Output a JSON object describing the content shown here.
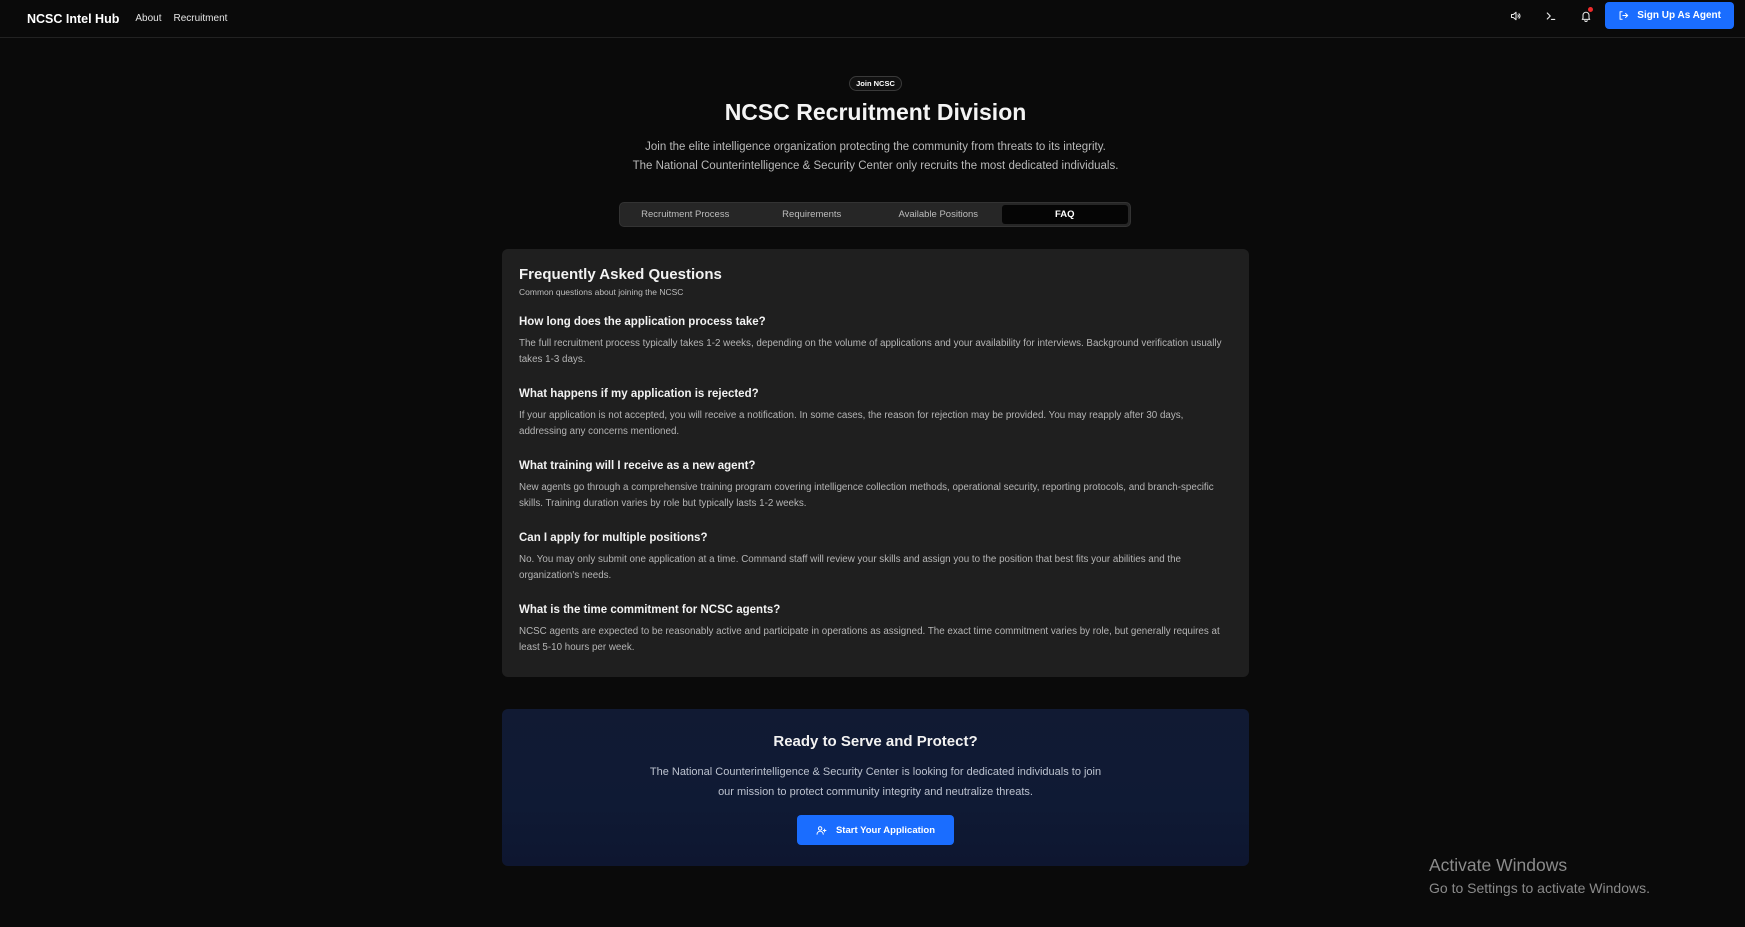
{
  "header": {
    "brand": "NCSC Intel Hub",
    "nav": [
      "About",
      "Recruitment"
    ],
    "signup_label": "Sign Up As Agent",
    "icons": [
      "speaker-icon",
      "terminal-icon",
      "bell-icon",
      "login-icon"
    ],
    "accent_color": "#1a6dff",
    "notification_dot_color": "#ef2b2b"
  },
  "hero": {
    "badge": "Join NCSC",
    "title": "NCSC Recruitment Division",
    "subtitle_line1": "Join the elite intelligence organization protecting the community from threats to its integrity.",
    "subtitle_line2": "The National Counterintelligence & Security Center only recruits the most dedicated individuals."
  },
  "tabs": [
    {
      "label": "Recruitment Process",
      "active": false
    },
    {
      "label": "Requirements",
      "active": false
    },
    {
      "label": "Available Positions",
      "active": false
    },
    {
      "label": "FAQ",
      "active": true
    }
  ],
  "faq": {
    "title": "Frequently Asked Questions",
    "subtitle": "Common questions about joining the NCSC",
    "items": [
      {
        "q": "How long does the application process take?",
        "a": "The full recruitment process typically takes 1-2 weeks, depending on the volume of applications and your availability for interviews. Background verification usually takes 1-3 days."
      },
      {
        "q": "What happens if my application is rejected?",
        "a": "If your application is not accepted, you will receive a notification. In some cases, the reason for rejection may be provided. You may reapply after 30 days, addressing any concerns mentioned."
      },
      {
        "q": "What training will I receive as a new agent?",
        "a": "New agents go through a comprehensive training program covering intelligence collection methods, operational security, reporting protocols, and branch-specific skills. Training duration varies by role but typically lasts 1-2 weeks."
      },
      {
        "q": "Can I apply for multiple positions?",
        "a": "No. You may only submit one application at a time. Command staff will review your skills and assign you to the position that best fits your abilities and the organization's needs."
      },
      {
        "q": "What is the time commitment for NCSC agents?",
        "a": "NCSC agents are expected to be reasonably active and participate in operations as assigned. The exact time commitment varies by role, but generally requires at least 5-10 hours per week."
      }
    ]
  },
  "cta": {
    "title": "Ready to Serve and Protect?",
    "text": "The National Counterintelligence & Security Center is looking for dedicated individuals to join our mission to protect community integrity and neutralize threats.",
    "button_label": "Start Your Application"
  },
  "watermark": {
    "title": "Activate Windows",
    "subtitle": "Go to Settings to activate Windows."
  }
}
